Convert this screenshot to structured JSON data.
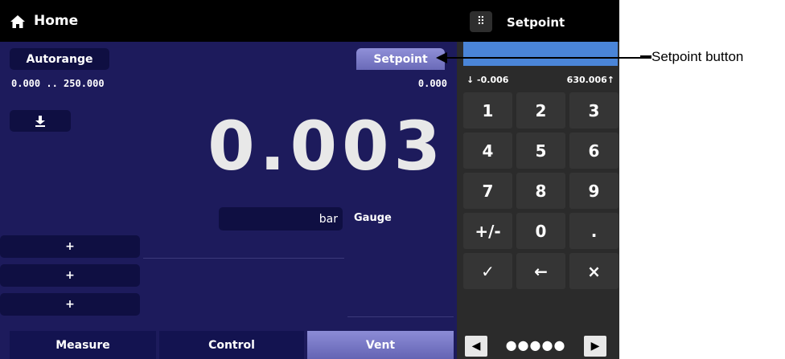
{
  "header": {
    "title": "Home",
    "icon": "home-icon"
  },
  "main": {
    "autorange_label": "Autorange",
    "range_text": "0.000 .. 250.000",
    "setpoint_label": "Setpoint",
    "setpoint_value": "0.000",
    "zero_button_icon": "zero-download-icon",
    "reading": "0.003",
    "unit_label": "bar",
    "mode_label": "Gauge",
    "plus_buttons": [
      "+",
      "+",
      "+"
    ]
  },
  "bottom_nav": {
    "measure": "Measure",
    "control": "Control",
    "vent": "Vent"
  },
  "keypad": {
    "title": "Setpoint",
    "grip_icon": "grip-icon",
    "range_low": "↓ -0.006",
    "range_high": "630.006↑",
    "keys": [
      "1",
      "2",
      "3",
      "4",
      "5",
      "6",
      "7",
      "8",
      "9",
      "+/-",
      "0",
      ".",
      "✓",
      "←",
      "×"
    ],
    "page_dots": "●●●●●"
  },
  "callout": {
    "text": "Setpoint button"
  },
  "colors": {
    "screen_bg": "#1d1b5c",
    "accent": "#6a6ab8",
    "entry_blue": "#4a85d8"
  }
}
